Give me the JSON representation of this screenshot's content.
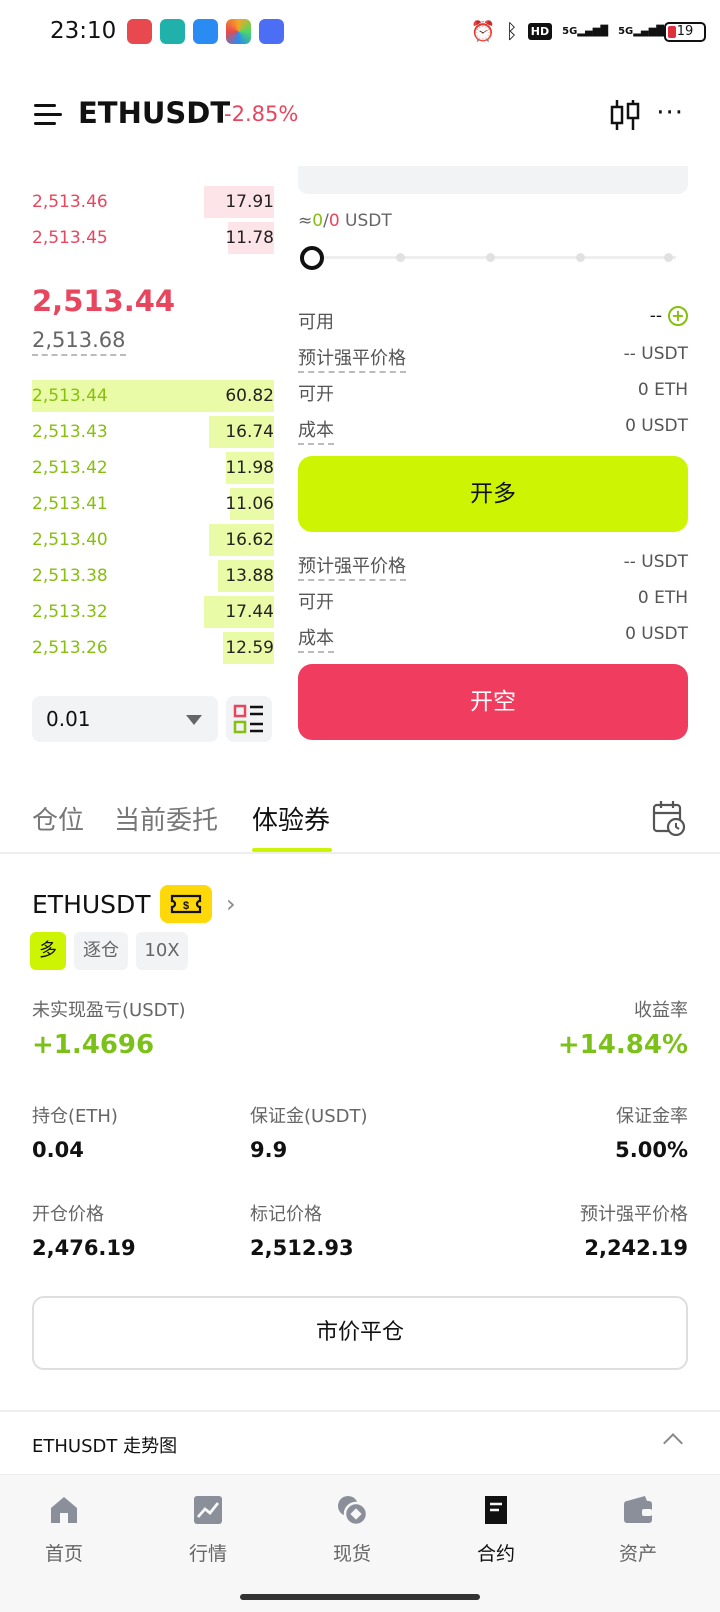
{
  "status_bar": {
    "time": "23:10",
    "battery": "19",
    "network_1": "5G",
    "network_2": "5G",
    "hd": "HD"
  },
  "header": {
    "pair": "ETHUSDT",
    "change": "-2.85%"
  },
  "order_book": {
    "asks": [
      {
        "price": "2,513.46",
        "qty": "17.91",
        "depth": 0.29
      },
      {
        "price": "2,513.45",
        "qty": "11.78",
        "depth": 0.19
      }
    ],
    "last_price": "2,513.44",
    "mark_price": "2,513.68",
    "bids": [
      {
        "price": "2,513.44",
        "qty": "60.82",
        "depth": 1.0
      },
      {
        "price": "2,513.43",
        "qty": "16.74",
        "depth": 0.27
      },
      {
        "price": "2,513.42",
        "qty": "11.98",
        "depth": 0.2
      },
      {
        "price": "2,513.41",
        "qty": "11.06",
        "depth": 0.18
      },
      {
        "price": "2,513.40",
        "qty": "16.62",
        "depth": 0.27
      },
      {
        "price": "2,513.38",
        "qty": "13.88",
        "depth": 0.23
      },
      {
        "price": "2,513.32",
        "qty": "17.44",
        "depth": 0.29
      },
      {
        "price": "2,513.26",
        "qty": "12.59",
        "depth": 0.21
      }
    ],
    "precision": "0.01"
  },
  "trade_panel": {
    "approx_prefix": "≈",
    "approx_long": "0",
    "approx_sep": "/",
    "approx_short": "0",
    "approx_unit": " USDT",
    "available_label": "可用",
    "available_value": "--",
    "long": {
      "liq_label": "预计强平价格",
      "liq_value": "-- USDT",
      "open_label": "可开",
      "open_value": "0 ETH",
      "cost_label": "成本",
      "cost_value": "0 USDT",
      "button": "开多"
    },
    "short": {
      "liq_label": "预计强平价格",
      "liq_value": "-- USDT",
      "open_label": "可开",
      "open_value": "0 ETH",
      "cost_label": "成本",
      "cost_value": "0 USDT",
      "button": "开空"
    }
  },
  "tabs": [
    {
      "label": "仓位"
    },
    {
      "label": "当前委托"
    },
    {
      "label": "体验券"
    }
  ],
  "position": {
    "symbol": "ETHUSDT",
    "side": "多",
    "margin_mode": "逐仓",
    "leverage": "10X",
    "unrealized_label": "未实现盈亏(USDT)",
    "unrealized_value": "+1.4696",
    "roi_label": "收益率",
    "roi_value": "+14.84%",
    "size_label": "持仓(ETH)",
    "size_value": "0.04",
    "margin_label": "保证金(USDT)",
    "margin_value": "9.9",
    "margin_rate_label": "保证金率",
    "margin_rate_value": "5.00%",
    "entry_label": "开仓价格",
    "entry_value": "2,476.19",
    "mark_label": "标记价格",
    "mark_value": "2,512.93",
    "liq_label": "预计强平价格",
    "liq_value": "2,242.19",
    "close_button": "市价平仓"
  },
  "trend": {
    "title": "ETHUSDT 走势图"
  },
  "bottom_nav": [
    {
      "label": "首页",
      "icon": "home-icon"
    },
    {
      "label": "行情",
      "icon": "market-chart-icon"
    },
    {
      "label": "现货",
      "icon": "spot-coins-icon"
    },
    {
      "label": "合约",
      "icon": "contract-document-icon"
    },
    {
      "label": "资产",
      "icon": "wallet-icon"
    }
  ],
  "colors": {
    "accent_lime": "#cdf503",
    "down_red": "#e8455e",
    "up_green": "#86bf0d",
    "short_button": "#f03d5f",
    "voucher_yellow": "#ffd80a"
  }
}
